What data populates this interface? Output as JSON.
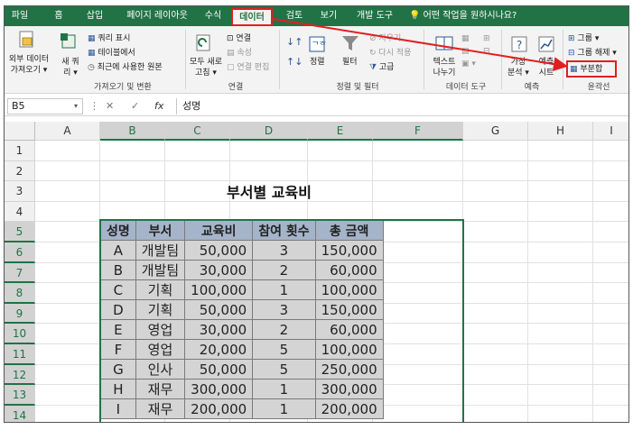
{
  "ribbon_tabs": [
    "파일",
    "홈",
    "삽입",
    "페이지 레이아웃",
    "수식",
    "데이터",
    "검토",
    "보기",
    "개발 도구"
  ],
  "active_tab": "데이터",
  "tell_me": "어떤 작업을 원하시나요?",
  "ribbon": {
    "get_external_data": [
      "외부 데이터",
      "가져오기 ▾"
    ],
    "new_query": [
      "새 쿼",
      "리 ▾"
    ],
    "show_queries": "쿼리 표시",
    "from_table": "테이블에서",
    "recent_sources": "최근에 사용한 원본",
    "group_get_transform": "가져오기 및 변환",
    "refresh_all": [
      "모두 새로",
      "고침 ▾"
    ],
    "connections": "연결",
    "properties": "속성",
    "edit_links": "연결 편집",
    "group_connections": "연결",
    "sort": "정렬",
    "filter": "필터",
    "clear": "지우기",
    "reapply": "다시 적용",
    "advanced": "고급",
    "group_sort_filter": "정렬 및 필터",
    "text_to_columns": [
      "텍스트",
      "나누기"
    ],
    "group_data_tools": "데이터 도구",
    "what_if": [
      "가상",
      "분석 ▾"
    ],
    "forecast_sheet": [
      "예측",
      "시트"
    ],
    "group_forecast": "예측",
    "group_btn": "그룹 ▾",
    "ungroup_btn": "그룹 해제 ▾",
    "subtotal": "부분합",
    "group_outline": "윤곽선"
  },
  "colors": {
    "excel_green": "#217346",
    "highlight_red": "#e0201e",
    "header_fill": "#a5b4c9",
    "cell_fill": "#d4d4d4"
  },
  "name_box": "B5",
  "formula_value": "성명",
  "columns": [
    "A",
    "B",
    "C",
    "D",
    "E",
    "F",
    "G",
    "H",
    "I"
  ],
  "rows": [
    "1",
    "2",
    "3",
    "4",
    "5",
    "6",
    "7",
    "8",
    "9",
    "10",
    "11",
    "12",
    "13",
    "14"
  ],
  "sheet_title": "부서별 교육비",
  "table": {
    "headers": [
      "성명",
      "부서",
      "교육비",
      "참여 횟수",
      "총 금액"
    ],
    "rows": [
      [
        "A",
        "개발팀",
        "50,000",
        "3",
        "150,000"
      ],
      [
        "B",
        "개발팀",
        "30,000",
        "2",
        "60,000"
      ],
      [
        "C",
        "기획",
        "100,000",
        "1",
        "100,000"
      ],
      [
        "D",
        "기획",
        "50,000",
        "3",
        "150,000"
      ],
      [
        "E",
        "영업",
        "30,000",
        "2",
        "60,000"
      ],
      [
        "F",
        "영업",
        "20,000",
        "5",
        "100,000"
      ],
      [
        "G",
        "인사",
        "50,000",
        "5",
        "250,000"
      ],
      [
        "H",
        "재무",
        "300,000",
        "1",
        "300,000"
      ],
      [
        "I",
        "재무",
        "200,000",
        "1",
        "200,000"
      ]
    ]
  }
}
